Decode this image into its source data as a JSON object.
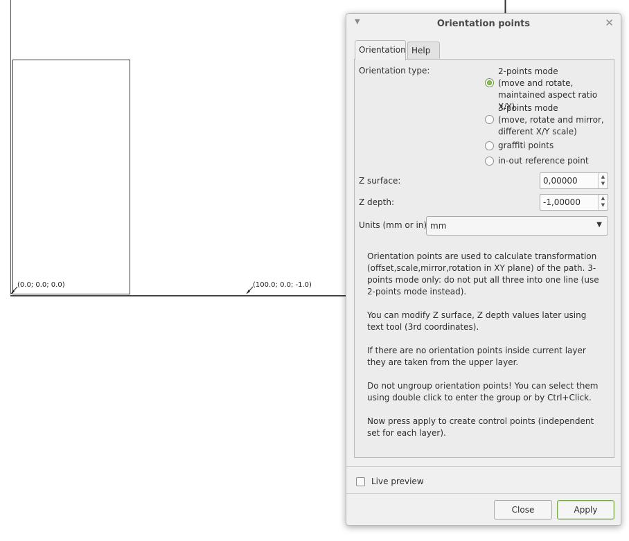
{
  "canvas": {
    "origin_label": "(0.0; 0.0; 0.0)",
    "second_label": "(100.0; 0.0; -1.0)"
  },
  "dialog": {
    "title": "Orientation points",
    "tabs": [
      {
        "label": "Orientation",
        "active": true
      },
      {
        "label": "Help",
        "active": false
      }
    ],
    "orientation_type_label": "Orientation type:",
    "modes": [
      {
        "label": "2-points mode\n(move and rotate,\nmaintained aspect ratio X/Y)",
        "checked": true
      },
      {
        "label": "3-points mode\n(move, rotate and mirror,\ndifferent X/Y scale)",
        "checked": false
      },
      {
        "label": "graffiti points",
        "checked": false
      },
      {
        "label": "in-out reference point",
        "checked": false
      }
    ],
    "z_surface": {
      "label": "Z surface:",
      "value": "0,00000"
    },
    "z_depth": {
      "label": "Z depth:",
      "value": "-1,00000"
    },
    "units": {
      "label": "Units (mm or in):",
      "value": "mm"
    },
    "info": [
      "Orientation points are used to calculate transformation (offset,scale,mirror,rotation in XY plane) of the path. 3-points mode only: do not put all three into one line (use 2-points mode instead).",
      "You can modify Z surface, Z depth values later using text tool (3rd coordinates).",
      "If there are no orientation points inside current layer they are taken from the upper layer.",
      "Do not ungroup orientation points! You can select them using double click to enter the group or by Ctrl+Click.",
      "Now press apply to create control points (independent set for each layer)."
    ],
    "live_preview": {
      "label": "Live preview",
      "checked": false
    },
    "buttons": {
      "close": "Close",
      "apply": "Apply"
    }
  },
  "icons": {
    "menu": "chevron-down-icon",
    "close": "close-icon",
    "arrow": "orientation-arrow-icon"
  }
}
